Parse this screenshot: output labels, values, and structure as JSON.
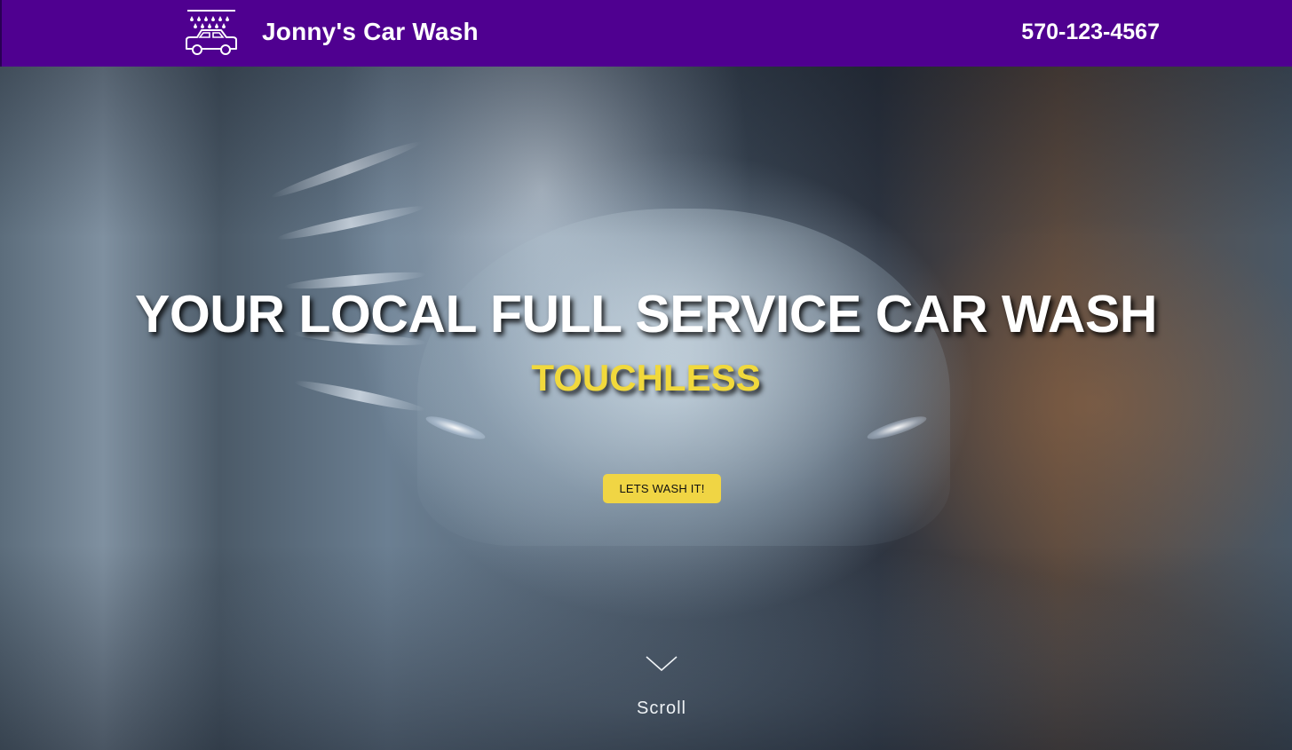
{
  "header": {
    "brand": "Jonny's Car Wash",
    "phone": "570-123-4567",
    "logo_icon": "car-wash-icon",
    "background": "#4f0090"
  },
  "hero": {
    "headline": "YOUR LOCAL FULL SERVICE CAR WASH",
    "subheadline": "TOUCHLESS",
    "cta_label": "LETS WASH IT!",
    "scroll_label": "Scroll",
    "scroll_icon": "chevron-down-icon",
    "accent": "#f0d544"
  }
}
